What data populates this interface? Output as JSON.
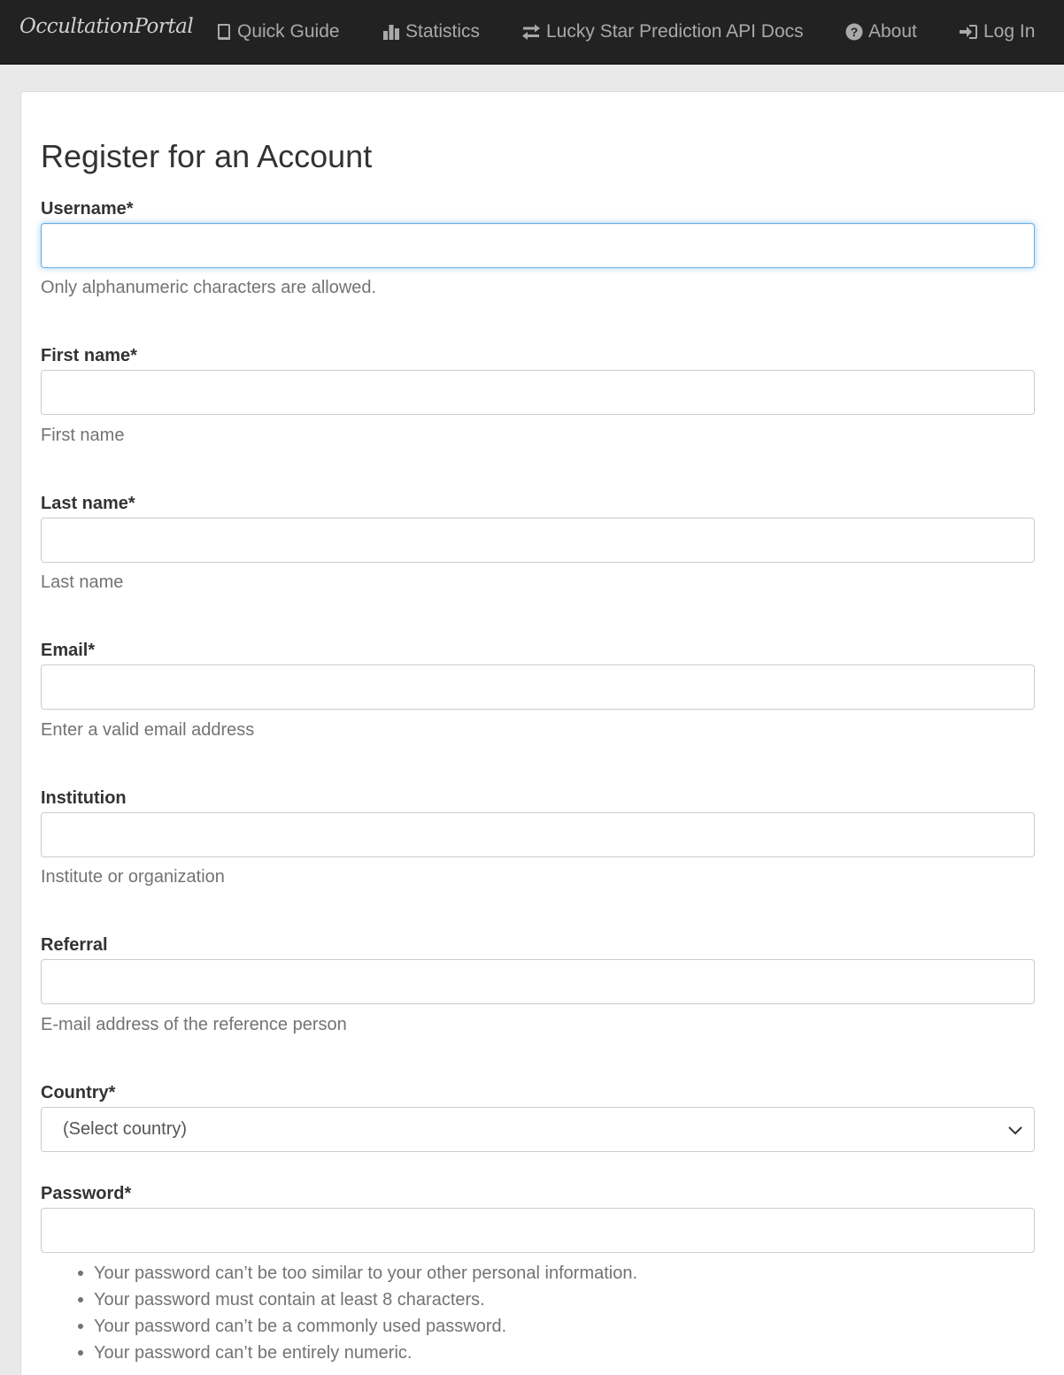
{
  "nav": {
    "brand": "OccultationPortal",
    "items": [
      {
        "label": "Quick Guide",
        "icon": "book-icon"
      },
      {
        "label": "Statistics",
        "icon": "bar-chart-icon"
      },
      {
        "label": "Lucky Star Prediction API Docs",
        "icon": "transfer-icon"
      },
      {
        "label": "About",
        "icon": "question-circle-icon"
      },
      {
        "label": "Log In",
        "icon": "log-in-icon"
      }
    ]
  },
  "form": {
    "title": "Register for an Account",
    "username": {
      "label": "Username*",
      "help": "Only alphanumeric characters are allowed.",
      "value": ""
    },
    "first_name": {
      "label": "First name*",
      "help": "First name",
      "value": ""
    },
    "last_name": {
      "label": "Last name*",
      "help": "Last name",
      "value": ""
    },
    "email": {
      "label": "Email*",
      "help": "Enter a valid email address",
      "value": ""
    },
    "institution": {
      "label": "Institution",
      "help": "Institute or organization",
      "value": ""
    },
    "referral": {
      "label": "Referral",
      "help": "E-mail address of the reference person",
      "value": ""
    },
    "country": {
      "label": "Country*",
      "selected": "(Select country)"
    },
    "password": {
      "label": "Password*",
      "value": "",
      "rules": [
        "Your password can’t be too similar to your other personal information.",
        "Your password must contain at least 8 characters.",
        "Your password can’t be a commonly used password.",
        "Your password can’t be entirely numeric."
      ]
    }
  }
}
